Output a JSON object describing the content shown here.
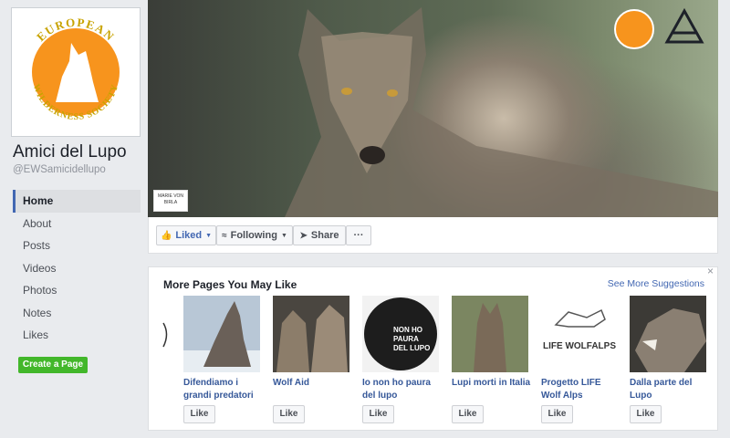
{
  "profile": {
    "logo_text_top": "EUROPEAN",
    "logo_text_bottom": "WILDERNESS SOCIETY",
    "name": "Amici del Lupo",
    "handle": "@EWSamicidellupo"
  },
  "nav": {
    "items": [
      {
        "label": "Home",
        "active": true
      },
      {
        "label": "About"
      },
      {
        "label": "Posts"
      },
      {
        "label": "Videos"
      },
      {
        "label": "Photos"
      },
      {
        "label": "Notes"
      },
      {
        "label": "Likes"
      }
    ],
    "create_page": "Create a Page"
  },
  "cover": {
    "badge_text": "MARIE VON BIRLA"
  },
  "actions": {
    "liked": "Liked",
    "following": "Following",
    "share": "Share",
    "more": "···"
  },
  "suggestions": {
    "title": "More Pages You May Like",
    "see_more": "See More Suggestions",
    "close": "×",
    "partial_label": "i",
    "cards": [
      {
        "name": "Difendiamo i grandi predatori",
        "like": "Like"
      },
      {
        "name": "Wolf Aid",
        "like": "Like"
      },
      {
        "name": "Io non ho paura del lupo",
        "like": "Like"
      },
      {
        "name": "Lupi morti in Italia",
        "like": "Like"
      },
      {
        "name": "Progetto LIFE Wolf Alps",
        "like": "Like"
      },
      {
        "name": "Dalla parte del Lupo",
        "like": "Like"
      }
    ],
    "thumb_texts": {
      "card3": "NON HO PAURA DEL LUPO",
      "card5": "LIFE WOLFALPS"
    }
  },
  "colors": {
    "accent": "#4267b2",
    "link": "#365899",
    "green": "#42b72a",
    "logo_orange": "#f7941d"
  }
}
